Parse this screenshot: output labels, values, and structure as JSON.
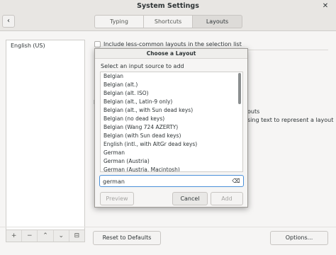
{
  "window": {
    "title": "System Settings",
    "close_glyph": "✕"
  },
  "header": {
    "back_glyph": "‹",
    "tabs": [
      {
        "label": "Typing"
      },
      {
        "label": "Shortcuts"
      },
      {
        "label": "Layouts",
        "selected": true
      }
    ]
  },
  "sidebar": {
    "items": [
      {
        "label": "English (US)"
      }
    ],
    "toolbar": {
      "add": "+",
      "remove": "−",
      "up": "⌃",
      "down": "⌄",
      "settings": "⊟"
    }
  },
  "main": {
    "checkbox_label": "Include less-common layouts in the selection list",
    "fragment_left": "D",
    "right_text_1": "outs",
    "right_text_2": "sing text to represent a layout",
    "reset_label": "Reset to Defaults",
    "options_label": "Options..."
  },
  "dialog": {
    "title": "Choose a Layout",
    "subtitle": "Select an input source to add",
    "items": [
      "Belgian",
      "Belgian (alt.)",
      "Belgian (alt. ISO)",
      "Belgian (alt., Latin-9 only)",
      "Belgian (alt., with Sun dead keys)",
      "Belgian (no dead keys)",
      "Belgian (Wang 724 AZERTY)",
      "Belgian (with Sun dead keys)",
      "English (intl., with AltGr dead keys)",
      "German",
      "German (Austria)",
      "German (Austria, Macintosh)"
    ],
    "search_value": "german",
    "clear_glyph": "⌫",
    "preview_label": "Preview",
    "cancel_label": "Cancel",
    "add_label": "Add"
  }
}
